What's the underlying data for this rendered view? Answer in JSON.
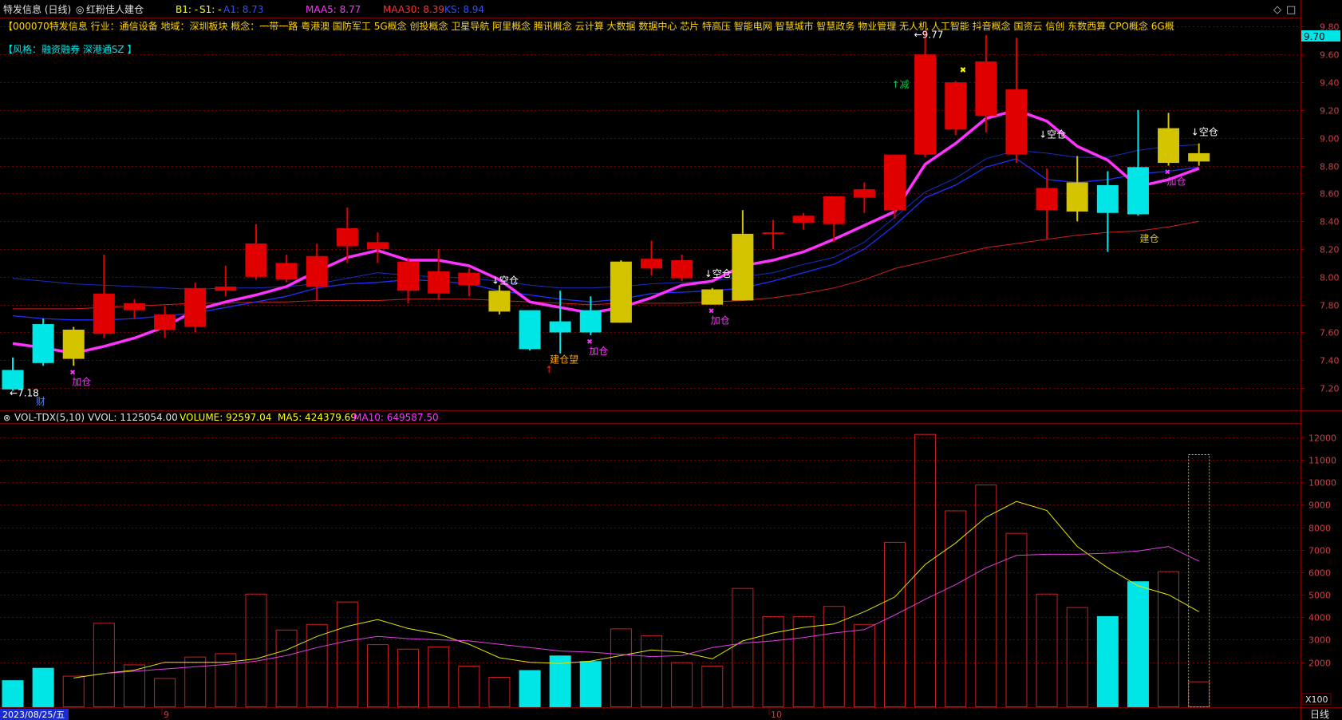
{
  "header": {
    "title": "特发信息 (日线)",
    "indicator_name": "红粉佳人建仓",
    "b1": "B1:  -",
    "s1": "S1:  -",
    "a1": "A1: 8.73",
    "maa5": "MAA5: 8.77",
    "maa30": "MAA30: 8.39",
    "ks": "KS: 8.94",
    "diamond_icon": "◇",
    "square_icon": "□"
  },
  "info": {
    "line1": "【000070特发信息  行业：通信设备  地域：深圳板块  概念：一带一路  粤港澳  国防军工  5G概念  创投概念  卫星导航  阿里概念  腾讯概念  云计算  大数据  数据中心  芯片  特高压  智能电网  智慧城市  智慧政务  物业管理  无人机  人工智能  抖音概念  国资云  信创  东数西算  CPO概念  6G概",
    "line2": "【风格：融资融券  深港通SZ 】"
  },
  "price_axis": {
    "ticks": [
      "9.80",
      "9.60",
      "9.40",
      "9.20",
      "9.00",
      "8.80",
      "8.60",
      "8.40",
      "8.20",
      "8.00",
      "7.80",
      "7.60",
      "7.40",
      "7.20"
    ],
    "current_price": "9.70"
  },
  "vol_header": {
    "name": "VOL-TDX(5,10)",
    "vvol": "VVOL: 1125054.00",
    "volume": "VOLUME: 92597.04",
    "ma5": "MA5: 424379.69",
    "ma10": "MA10: 649587.50"
  },
  "vol_axis": {
    "ticks": [
      "12000",
      "11000",
      "10000",
      "9000",
      "8000",
      "7000",
      "6000",
      "5000",
      "4000",
      "3000",
      "2000"
    ],
    "unit": "X100"
  },
  "x_axis": {
    "date": "2023/08/25/五",
    "month_marks": [
      "9",
      "10"
    ],
    "period": "日线"
  },
  "annotations": {
    "high": "9.77",
    "low": "7.18",
    "cai": "财",
    "jiancang": "建仓",
    "kongcang": "空仓",
    "jiacang": "加仓",
    "jian": "减",
    "jiancangwang": "建仓望"
  },
  "colors": {
    "up": "#e00000",
    "down": "#00e5e5",
    "yellow": "#d4c400",
    "magenta": "#ff33ff",
    "blue": "#1f2fff",
    "red_line": "#cc2020",
    "grid": "#7a0000",
    "orange": "#ffa500",
    "white": "#ffffff"
  },
  "chart_data": {
    "type": "candlestick",
    "price_ylim": [
      7.04,
      9.86
    ],
    "candles": [
      {
        "o": 7.33,
        "h": 7.42,
        "l": 7.18,
        "c": 7.19,
        "col": "cyan",
        "vol": 1200
      },
      {
        "o": 7.66,
        "h": 7.7,
        "l": 7.36,
        "c": 7.38,
        "col": "cyan",
        "vol": 1750
      },
      {
        "o": 7.41,
        "h": 7.64,
        "l": 7.36,
        "c": 7.62,
        "col": "yellow",
        "vol": 1400
      },
      {
        "o": 7.59,
        "h": 8.16,
        "l": 7.56,
        "c": 7.88,
        "col": "red",
        "vol": 3750
      },
      {
        "o": 7.76,
        "h": 7.84,
        "l": 7.7,
        "c": 7.81,
        "col": "red",
        "vol": 1900
      },
      {
        "o": 7.62,
        "h": 7.79,
        "l": 7.56,
        "c": 7.73,
        "col": "red",
        "vol": 1300
      },
      {
        "o": 7.64,
        "h": 7.96,
        "l": 7.6,
        "c": 7.92,
        "col": "red",
        "vol": 2250
      },
      {
        "o": 7.9,
        "h": 8.08,
        "l": 7.86,
        "c": 7.93,
        "col": "red",
        "vol": 2400
      },
      {
        "o": 8.0,
        "h": 8.38,
        "l": 7.98,
        "c": 8.24,
        "col": "red",
        "vol": 5050
      },
      {
        "o": 7.98,
        "h": 8.16,
        "l": 7.96,
        "c": 8.1,
        "col": "red",
        "vol": 3450
      },
      {
        "o": 7.93,
        "h": 8.24,
        "l": 7.83,
        "c": 8.15,
        "col": "red",
        "vol": 3700
      },
      {
        "o": 8.22,
        "h": 8.5,
        "l": 8.1,
        "c": 8.35,
        "col": "red",
        "vol": 4700
      },
      {
        "o": 8.2,
        "h": 8.32,
        "l": 8.1,
        "c": 8.25,
        "col": "red",
        "vol": 2800
      },
      {
        "o": 7.9,
        "h": 8.14,
        "l": 7.81,
        "c": 8.11,
        "col": "red",
        "vol": 2600
      },
      {
        "o": 7.88,
        "h": 8.2,
        "l": 7.84,
        "c": 8.04,
        "col": "red",
        "vol": 2700
      },
      {
        "o": 7.94,
        "h": 8.06,
        "l": 7.86,
        "c": 8.03,
        "col": "red",
        "vol": 1850
      },
      {
        "o": 7.9,
        "h": 7.94,
        "l": 7.73,
        "c": 7.75,
        "col": "yellow",
        "vol": 1350
      },
      {
        "o": 7.76,
        "h": 7.76,
        "l": 7.47,
        "c": 7.48,
        "col": "cyan",
        "vol": 1650
      },
      {
        "o": 7.6,
        "h": 7.9,
        "l": 7.45,
        "c": 7.68,
        "col": "cyan",
        "vol": 2300
      },
      {
        "o": 7.76,
        "h": 7.86,
        "l": 7.58,
        "c": 7.6,
        "col": "cyan",
        "vol": 2050
      },
      {
        "o": 7.67,
        "h": 8.12,
        "l": 7.67,
        "c": 8.11,
        "col": "yellow",
        "vol": 3500
      },
      {
        "o": 8.06,
        "h": 8.26,
        "l": 8.01,
        "c": 8.13,
        "col": "red",
        "vol": 3200
      },
      {
        "o": 7.99,
        "h": 8.16,
        "l": 7.97,
        "c": 8.12,
        "col": "red",
        "vol": 2000
      },
      {
        "o": 7.91,
        "h": 7.92,
        "l": 7.8,
        "c": 7.8,
        "col": "yellow",
        "vol": 1850
      },
      {
        "o": 8.31,
        "h": 8.48,
        "l": 7.83,
        "c": 7.83,
        "col": "yellow",
        "vol": 5300
      },
      {
        "o": 8.31,
        "h": 8.41,
        "l": 8.2,
        "c": 8.32,
        "col": "red",
        "vol": 4050
      },
      {
        "o": 8.39,
        "h": 8.46,
        "l": 8.34,
        "c": 8.44,
        "col": "red",
        "vol": 4050
      },
      {
        "o": 8.38,
        "h": 8.58,
        "l": 8.25,
        "c": 8.58,
        "col": "red",
        "vol": 4500
      },
      {
        "o": 8.57,
        "h": 8.68,
        "l": 8.46,
        "c": 8.63,
        "col": "red",
        "vol": 3700
      },
      {
        "o": 8.48,
        "h": 8.88,
        "l": 8.42,
        "c": 8.88,
        "col": "red",
        "vol": 7350
      },
      {
        "o": 8.88,
        "h": 9.77,
        "l": 8.86,
        "c": 9.6,
        "col": "red",
        "vol": 12150
      },
      {
        "o": 9.06,
        "h": 9.41,
        "l": 9.02,
        "c": 9.4,
        "col": "red",
        "vol": 8750
      },
      {
        "o": 9.16,
        "h": 9.74,
        "l": 9.04,
        "c": 9.55,
        "col": "red",
        "vol": 9900
      },
      {
        "o": 8.88,
        "h": 9.72,
        "l": 8.82,
        "c": 9.35,
        "col": "red",
        "vol": 7750
      },
      {
        "o": 8.48,
        "h": 8.78,
        "l": 8.27,
        "c": 8.64,
        "col": "red",
        "vol": 5050
      },
      {
        "o": 8.68,
        "h": 8.87,
        "l": 8.4,
        "c": 8.47,
        "col": "yellow",
        "vol": 4450
      },
      {
        "o": 8.66,
        "h": 8.76,
        "l": 8.18,
        "c": 8.46,
        "col": "cyan",
        "vol": 4050
      },
      {
        "o": 8.79,
        "h": 9.2,
        "l": 8.44,
        "c": 8.45,
        "col": "cyan",
        "vol": 5600
      },
      {
        "o": 8.82,
        "h": 9.18,
        "l": 8.8,
        "c": 9.07,
        "col": "yellow",
        "vol": 6050
      },
      {
        "o": 8.83,
        "h": 8.96,
        "l": 8.8,
        "c": 8.89,
        "col": "yellow",
        "vol": 1150
      }
    ],
    "vol_ylim": [
      0,
      12600
    ],
    "maa5": [
      7.52,
      7.49,
      7.45,
      7.5,
      7.56,
      7.64,
      7.76,
      7.82,
      7.87,
      7.93,
      8.04,
      8.14,
      8.19,
      8.12,
      8.12,
      8.08,
      7.98,
      7.82,
      7.78,
      7.74,
      7.78,
      7.85,
      7.94,
      7.97,
      8.08,
      8.12,
      8.18,
      8.27,
      8.37,
      8.47,
      8.81,
      8.96,
      9.14,
      9.2,
      9.12,
      8.94,
      8.84,
      8.65,
      8.7,
      8.78
    ],
    "line_blue": [
      7.72,
      7.7,
      7.69,
      7.69,
      7.7,
      7.72,
      7.74,
      7.78,
      7.82,
      7.86,
      7.92,
      7.95,
      7.96,
      7.98,
      7.97,
      7.95,
      7.9,
      7.87,
      7.84,
      7.82,
      7.84,
      7.88,
      7.89,
      7.9,
      7.92,
      7.97,
      8.03,
      8.09,
      8.2,
      8.37,
      8.57,
      8.66,
      8.79,
      8.85,
      8.7,
      8.68,
      8.7,
      8.74,
      8.76,
      8.79
    ],
    "line_navy": [
      7.99,
      7.97,
      7.95,
      7.94,
      7.93,
      7.92,
      7.91,
      7.92,
      7.92,
      7.93,
      7.95,
      7.99,
      8.03,
      8.01,
      8.0,
      7.99,
      7.97,
      7.94,
      7.92,
      7.92,
      7.93,
      7.95,
      7.96,
      7.97,
      8.0,
      8.03,
      8.09,
      8.14,
      8.25,
      8.43,
      8.61,
      8.71,
      8.85,
      8.91,
      8.89,
      8.86,
      8.86,
      8.91,
      8.94,
      8.95
    ],
    "line_red": [
      7.77,
      7.77,
      7.77,
      7.78,
      7.79,
      7.8,
      7.81,
      7.81,
      7.82,
      7.82,
      7.83,
      7.83,
      7.83,
      7.84,
      7.84,
      7.84,
      7.83,
      7.82,
      7.81,
      7.8,
      7.81,
      7.81,
      7.81,
      7.82,
      7.83,
      7.85,
      7.88,
      7.92,
      7.98,
      8.06,
      8.11,
      8.16,
      8.21,
      8.24,
      8.27,
      8.3,
      8.32,
      8.33,
      8.36,
      8.4
    ],
    "vol_ma5": [
      1300,
      1500,
      1650,
      2000,
      2000,
      2000,
      2150,
      2550,
      3150,
      3600,
      3900,
      3500,
      3250,
      2800,
      2200,
      2000,
      1950,
      2050,
      2300,
      2550,
      2450,
      2150,
      2950,
      3300,
      3550,
      3700,
      4250,
      4900,
      6350,
      7300,
      8450,
      9150,
      8750,
      7150,
      6200,
      5400,
      5000,
      4250
    ],
    "vol_ma10": [
      1500,
      1600,
      1700,
      1800,
      1900,
      2050,
      2300,
      2650,
      2950,
      3150,
      3050,
      3000,
      2950,
      2800,
      2650,
      2500,
      2450,
      2350,
      2250,
      2300,
      2650,
      2850,
      2950,
      3100,
      3300,
      3450,
      4100,
      4800,
      5450,
      6200,
      6750,
      6800,
      6800,
      6850,
      6950,
      7150,
      6500
    ]
  }
}
